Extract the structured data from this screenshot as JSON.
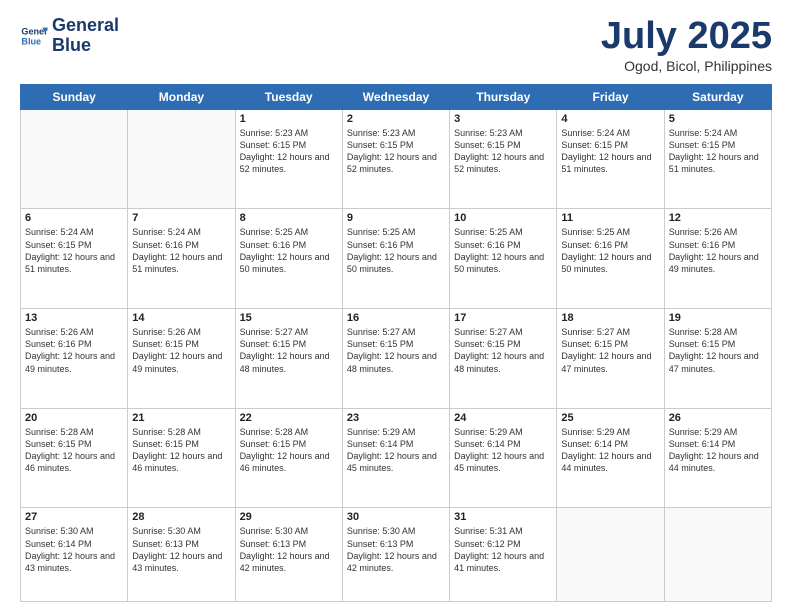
{
  "logo": {
    "line1": "General",
    "line2": "Blue"
  },
  "title": "July 2025",
  "subtitle": "Ogod, Bicol, Philippines",
  "weekdays": [
    "Sunday",
    "Monday",
    "Tuesday",
    "Wednesday",
    "Thursday",
    "Friday",
    "Saturday"
  ],
  "weeks": [
    [
      {
        "day": "",
        "info": ""
      },
      {
        "day": "",
        "info": ""
      },
      {
        "day": "1",
        "info": "Sunrise: 5:23 AM\nSunset: 6:15 PM\nDaylight: 12 hours and 52 minutes."
      },
      {
        "day": "2",
        "info": "Sunrise: 5:23 AM\nSunset: 6:15 PM\nDaylight: 12 hours and 52 minutes."
      },
      {
        "day": "3",
        "info": "Sunrise: 5:23 AM\nSunset: 6:15 PM\nDaylight: 12 hours and 52 minutes."
      },
      {
        "day": "4",
        "info": "Sunrise: 5:24 AM\nSunset: 6:15 PM\nDaylight: 12 hours and 51 minutes."
      },
      {
        "day": "5",
        "info": "Sunrise: 5:24 AM\nSunset: 6:15 PM\nDaylight: 12 hours and 51 minutes."
      }
    ],
    [
      {
        "day": "6",
        "info": "Sunrise: 5:24 AM\nSunset: 6:15 PM\nDaylight: 12 hours and 51 minutes."
      },
      {
        "day": "7",
        "info": "Sunrise: 5:24 AM\nSunset: 6:16 PM\nDaylight: 12 hours and 51 minutes."
      },
      {
        "day": "8",
        "info": "Sunrise: 5:25 AM\nSunset: 6:16 PM\nDaylight: 12 hours and 50 minutes."
      },
      {
        "day": "9",
        "info": "Sunrise: 5:25 AM\nSunset: 6:16 PM\nDaylight: 12 hours and 50 minutes."
      },
      {
        "day": "10",
        "info": "Sunrise: 5:25 AM\nSunset: 6:16 PM\nDaylight: 12 hours and 50 minutes."
      },
      {
        "day": "11",
        "info": "Sunrise: 5:25 AM\nSunset: 6:16 PM\nDaylight: 12 hours and 50 minutes."
      },
      {
        "day": "12",
        "info": "Sunrise: 5:26 AM\nSunset: 6:16 PM\nDaylight: 12 hours and 49 minutes."
      }
    ],
    [
      {
        "day": "13",
        "info": "Sunrise: 5:26 AM\nSunset: 6:16 PM\nDaylight: 12 hours and 49 minutes."
      },
      {
        "day": "14",
        "info": "Sunrise: 5:26 AM\nSunset: 6:15 PM\nDaylight: 12 hours and 49 minutes."
      },
      {
        "day": "15",
        "info": "Sunrise: 5:27 AM\nSunset: 6:15 PM\nDaylight: 12 hours and 48 minutes."
      },
      {
        "day": "16",
        "info": "Sunrise: 5:27 AM\nSunset: 6:15 PM\nDaylight: 12 hours and 48 minutes."
      },
      {
        "day": "17",
        "info": "Sunrise: 5:27 AM\nSunset: 6:15 PM\nDaylight: 12 hours and 48 minutes."
      },
      {
        "day": "18",
        "info": "Sunrise: 5:27 AM\nSunset: 6:15 PM\nDaylight: 12 hours and 47 minutes."
      },
      {
        "day": "19",
        "info": "Sunrise: 5:28 AM\nSunset: 6:15 PM\nDaylight: 12 hours and 47 minutes."
      }
    ],
    [
      {
        "day": "20",
        "info": "Sunrise: 5:28 AM\nSunset: 6:15 PM\nDaylight: 12 hours and 46 minutes."
      },
      {
        "day": "21",
        "info": "Sunrise: 5:28 AM\nSunset: 6:15 PM\nDaylight: 12 hours and 46 minutes."
      },
      {
        "day": "22",
        "info": "Sunrise: 5:28 AM\nSunset: 6:15 PM\nDaylight: 12 hours and 46 minutes."
      },
      {
        "day": "23",
        "info": "Sunrise: 5:29 AM\nSunset: 6:14 PM\nDaylight: 12 hours and 45 minutes."
      },
      {
        "day": "24",
        "info": "Sunrise: 5:29 AM\nSunset: 6:14 PM\nDaylight: 12 hours and 45 minutes."
      },
      {
        "day": "25",
        "info": "Sunrise: 5:29 AM\nSunset: 6:14 PM\nDaylight: 12 hours and 44 minutes."
      },
      {
        "day": "26",
        "info": "Sunrise: 5:29 AM\nSunset: 6:14 PM\nDaylight: 12 hours and 44 minutes."
      }
    ],
    [
      {
        "day": "27",
        "info": "Sunrise: 5:30 AM\nSunset: 6:14 PM\nDaylight: 12 hours and 43 minutes."
      },
      {
        "day": "28",
        "info": "Sunrise: 5:30 AM\nSunset: 6:13 PM\nDaylight: 12 hours and 43 minutes."
      },
      {
        "day": "29",
        "info": "Sunrise: 5:30 AM\nSunset: 6:13 PM\nDaylight: 12 hours and 42 minutes."
      },
      {
        "day": "30",
        "info": "Sunrise: 5:30 AM\nSunset: 6:13 PM\nDaylight: 12 hours and 42 minutes."
      },
      {
        "day": "31",
        "info": "Sunrise: 5:31 AM\nSunset: 6:12 PM\nDaylight: 12 hours and 41 minutes."
      },
      {
        "day": "",
        "info": ""
      },
      {
        "day": "",
        "info": ""
      }
    ]
  ]
}
